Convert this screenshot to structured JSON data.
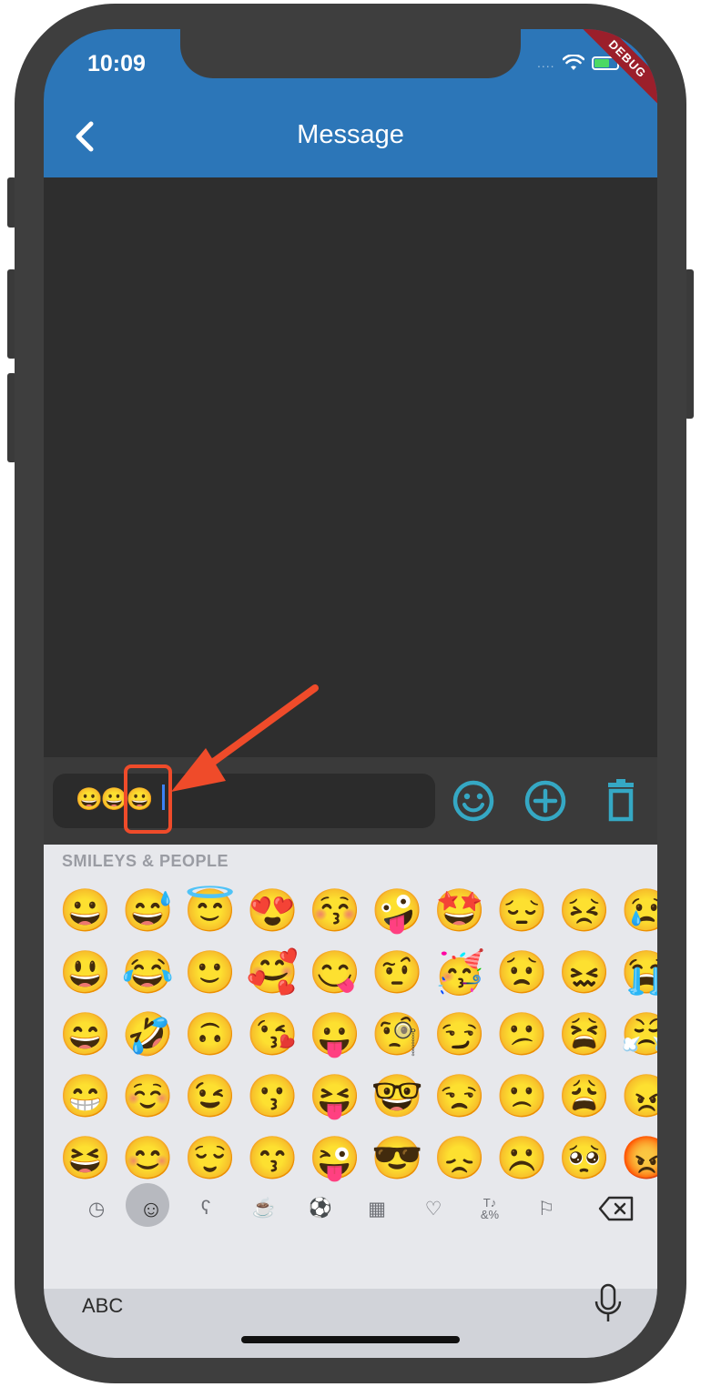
{
  "status_bar": {
    "time": "10:09",
    "signal": "....",
    "debug_label": "DEBUG"
  },
  "header": {
    "title": "Message",
    "back_icon": "chevron-left-icon"
  },
  "composer": {
    "text_value": "😀😀😀",
    "actions": [
      {
        "name": "emoji-toggle-button",
        "icon": "smiley-face-icon"
      },
      {
        "name": "add-button",
        "icon": "plus-circle-icon"
      },
      {
        "name": "delete-button",
        "icon": "trash-icon"
      }
    ],
    "accent_color": "#35a8c4"
  },
  "colors": {
    "app_bar": "#2c76b8",
    "annotation": "#ef4b2a"
  },
  "keyboard": {
    "category_title": "SMILEYS & PEOPLE",
    "emoji_rows": [
      [
        "😀",
        "😅",
        "😇",
        "😍",
        "😚",
        "🤪",
        "🤩",
        "😔",
        "😣",
        "😢"
      ],
      [
        "😃",
        "😂",
        "🙂",
        "🥰",
        "😋",
        "🤨",
        "🥳",
        "😟",
        "😖",
        "😭"
      ],
      [
        "😄",
        "🤣",
        "🙃",
        "😘",
        "😛",
        "🧐",
        "😏",
        "😕",
        "😫",
        "😤"
      ],
      [
        "😁",
        "☺️",
        "😉",
        "😗",
        "😝",
        "🤓",
        "😒",
        "🙁",
        "😩",
        "😠"
      ],
      [
        "😆",
        "😊",
        "😌",
        "😙",
        "😜",
        "😎",
        "😞",
        "☹️",
        "🥺",
        "😡"
      ]
    ],
    "categories": [
      {
        "name": "recent",
        "icon": "clock-icon",
        "glyph": "◷"
      },
      {
        "name": "smileys",
        "icon": "smiley-icon",
        "glyph": "☺"
      },
      {
        "name": "animals",
        "icon": "bear-icon",
        "glyph": "ʕ"
      },
      {
        "name": "food",
        "icon": "burger-icon",
        "glyph": "☕"
      },
      {
        "name": "activity",
        "icon": "soccer-ball-icon",
        "glyph": "⚽"
      },
      {
        "name": "travel",
        "icon": "building-icon",
        "glyph": "▦"
      },
      {
        "name": "objects",
        "icon": "lightbulb-icon",
        "glyph": "♡"
      },
      {
        "name": "symbols",
        "icon": "symbols-icon",
        "glyph": "♪"
      },
      {
        "name": "flags",
        "icon": "flag-icon",
        "glyph": "⚐"
      }
    ],
    "symbols_label": "T♪ &%",
    "abc_label": "ABC"
  }
}
